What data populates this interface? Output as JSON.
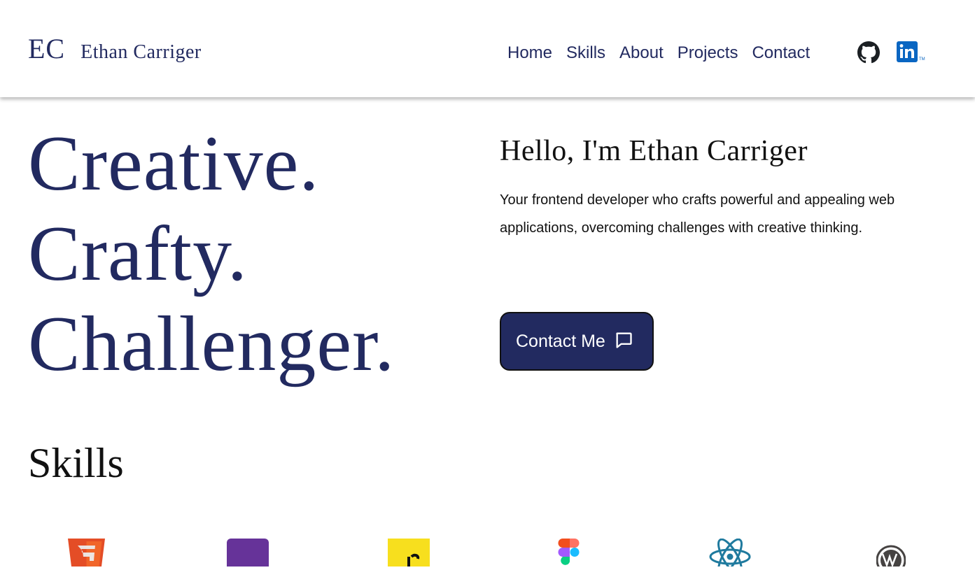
{
  "header": {
    "initials": "EC",
    "name": "Ethan Carriger",
    "nav": [
      "Home",
      "Skills",
      "About",
      "Projects",
      "Contact"
    ],
    "social": [
      "github-icon",
      "linkedin-icon"
    ]
  },
  "hero": {
    "words": [
      "Creative.",
      "Crafty.",
      "Challenger."
    ]
  },
  "intro": {
    "title": "Hello, I'm Ethan Carriger",
    "text": "Your frontend developer who crafts powerful and appealing web applications, overcoming challenges with creative thinking.",
    "button_label": "Contact Me",
    "button_icon": "chat-bubble-icon"
  },
  "skills": {
    "title": "Skills",
    "icons": [
      "html5-icon",
      "css-icon",
      "javascript-icon",
      "figma-icon",
      "react-icon",
      "wordpress-icon"
    ]
  },
  "colors": {
    "brand_navy": "#222a60",
    "text_dark": "#111111",
    "linkedin_blue": "#0a66c2",
    "html_orange": "#e44d26",
    "css_purple": "#663399",
    "js_yellow": "#f7df1e",
    "react_blue": "#1f7a9e"
  }
}
